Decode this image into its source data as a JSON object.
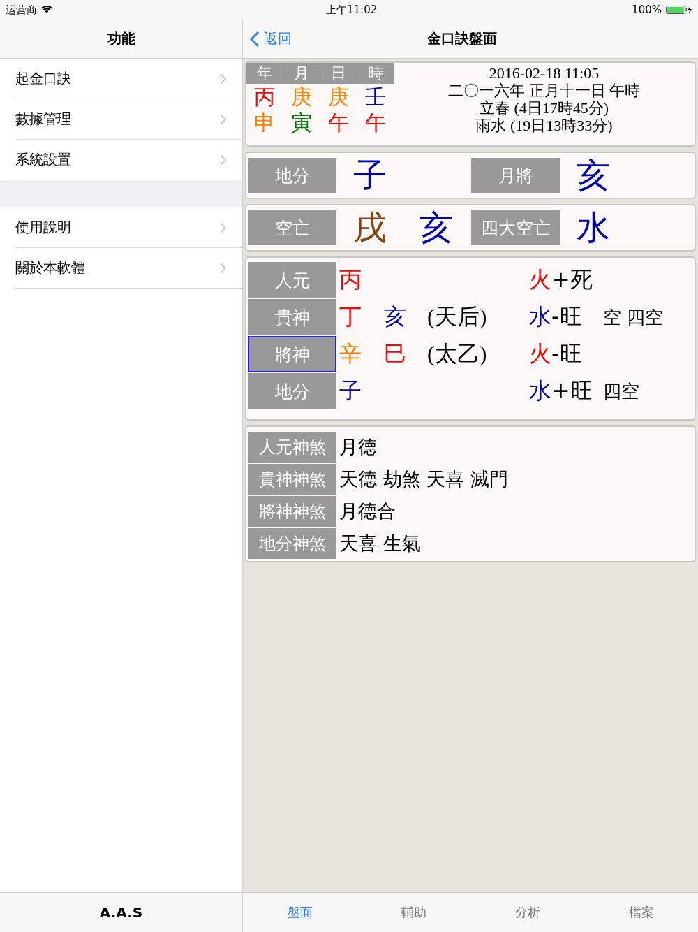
{
  "status_bar": {
    "carrier": "运营商",
    "time": "上午11:02",
    "battery": "100%"
  },
  "sidebar": {
    "title": "功能",
    "sections": [
      [
        {
          "label": "起金口訣"
        },
        {
          "label": "數據管理"
        },
        {
          "label": "系統設置"
        }
      ],
      [
        {
          "label": "使用說明"
        },
        {
          "label": "關於本軟體"
        }
      ]
    ],
    "footer": "A.A.S"
  },
  "nav": {
    "back": "返回",
    "title": "金口訣盤面"
  },
  "pillars": {
    "headers": [
      "年",
      "月",
      "日",
      "時"
    ],
    "stems": [
      {
        "text": "丙",
        "color": "#ff0000"
      },
      {
        "text": "庚",
        "color": "#ff7f00"
      },
      {
        "text": "庚",
        "color": "#ff7f00"
      },
      {
        "text": "壬",
        "color": "#0000aa"
      }
    ],
    "branches": [
      {
        "text": "申",
        "color": "#ff7f00"
      },
      {
        "text": "寅",
        "color": "#008000"
      },
      {
        "text": "午",
        "color": "#ff0000"
      },
      {
        "text": "午",
        "color": "#ff0000"
      }
    ]
  },
  "date_info": [
    "2016-02-18 11:05",
    "二〇一六年 正月十一日 午時",
    "立春 (4日17時45分)",
    "雨水 (19日13時33分)"
  ],
  "panels": [
    [
      {
        "label": "地分",
        "values": [
          {
            "text": "子",
            "color": "#0000aa"
          }
        ]
      },
      {
        "label": "月將",
        "values": [
          {
            "text": "亥",
            "color": "#0000aa"
          }
        ]
      }
    ],
    [
      {
        "label": "空亡",
        "values": [
          {
            "text": "戌",
            "color": "#8b4513"
          },
          {
            "text": "亥",
            "color": "#0000aa"
          }
        ]
      },
      {
        "label": "四大空亡",
        "values": [
          {
            "text": "水",
            "color": "#0000aa"
          }
        ]
      }
    ]
  ],
  "layers": [
    {
      "label": "人元",
      "selected": false,
      "chars": [
        {
          "text": "丙",
          "color": "#ff0000"
        }
      ],
      "element": {
        "text": "火",
        "color": "#ff0000"
      },
      "state": "+死"
    },
    {
      "label": "貴神",
      "selected": false,
      "chars": [
        {
          "text": "丁",
          "color": "#ff0000"
        },
        {
          "text": "亥",
          "color": "#0000aa"
        }
      ],
      "general": "(天后)",
      "element": {
        "text": "水",
        "color": "#0000aa"
      },
      "state": "-旺",
      "tags": "空 四空"
    },
    {
      "label": "將神",
      "selected": true,
      "chars": [
        {
          "text": "辛",
          "color": "#ff7f00"
        },
        {
          "text": "巳",
          "color": "#ff0000"
        }
      ],
      "general": "(太乙)",
      "element": {
        "text": "火",
        "color": "#ff0000"
      },
      "state": "-旺"
    },
    {
      "label": "地分",
      "selected": false,
      "chars": [
        {
          "text": "子",
          "color": "#0000aa"
        }
      ],
      "element": {
        "text": "水",
        "color": "#0000aa"
      },
      "state": "+旺",
      "tags": "四空"
    }
  ],
  "shensha": [
    {
      "label": "人元神煞",
      "value": "月德"
    },
    {
      "label": "貴神神煞",
      "value": "天德 劫煞 天喜 滅門"
    },
    {
      "label": "將神神煞",
      "value": "月德合"
    },
    {
      "label": "地分神煞",
      "value": "天喜 生氣"
    }
  ],
  "tabs": [
    {
      "label": "盤面",
      "selected": true
    },
    {
      "label": "輔助",
      "selected": false
    },
    {
      "label": "分析",
      "selected": false
    },
    {
      "label": "檔案",
      "selected": false
    }
  ]
}
